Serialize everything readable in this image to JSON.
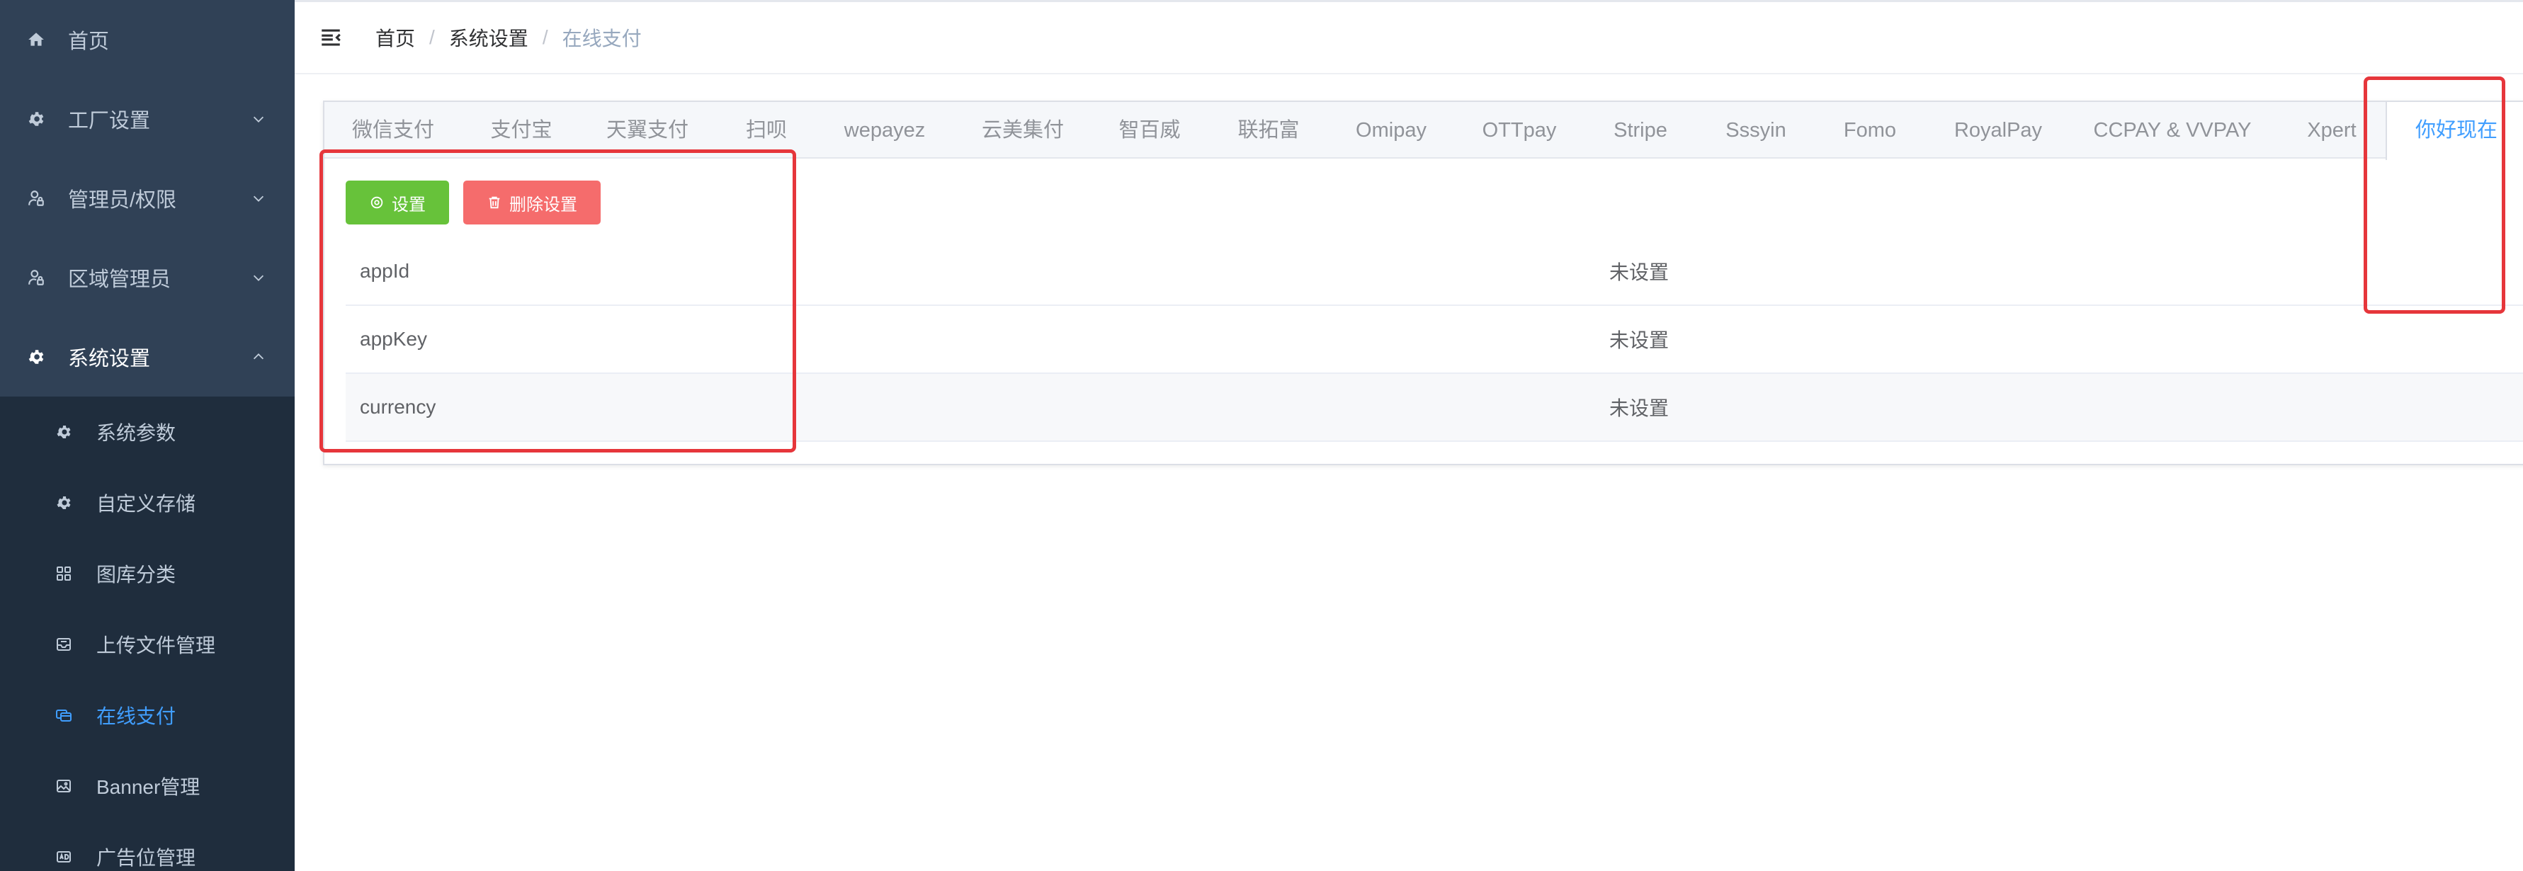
{
  "sidebar": {
    "items": [
      {
        "label": "首页",
        "icon": "home-icon",
        "has_arrow": false
      },
      {
        "label": "工厂设置",
        "icon": "gear-icon",
        "has_arrow": true,
        "arrow": "down"
      },
      {
        "label": "管理员/权限",
        "icon": "user-lock-icon",
        "has_arrow": true,
        "arrow": "down"
      },
      {
        "label": "区域管理员",
        "icon": "user-lock-icon",
        "has_arrow": true,
        "arrow": "down"
      },
      {
        "label": "系统设置",
        "icon": "gear-icon",
        "has_arrow": true,
        "arrow": "up",
        "expanded": true
      }
    ],
    "submenu": [
      {
        "label": "系统参数",
        "icon": "gear-icon"
      },
      {
        "label": "自定义存储",
        "icon": "gear-icon"
      },
      {
        "label": "图库分类",
        "icon": "grid-icon"
      },
      {
        "label": "上传文件管理",
        "icon": "inbox-icon"
      },
      {
        "label": "在线支付",
        "icon": "payment-icon",
        "active": true
      },
      {
        "label": "Banner管理",
        "icon": "image-icon"
      },
      {
        "label": "广告位管理",
        "icon": "ad-icon"
      }
    ]
  },
  "header": {
    "breadcrumb": {
      "home": "首页",
      "sep1": "/",
      "parent": "系统设置",
      "sep2": "/",
      "current": "在线支付"
    }
  },
  "tabs": [
    "微信支付",
    "支付宝",
    "天翼支付",
    "扫呗",
    "wepayez",
    "云美集付",
    "智百威",
    "联拓富",
    "Omipay",
    "OTTpay",
    "Stripe",
    "Sssyin",
    "Fomo",
    "RoyalPay",
    "CCPAY & VVPAY",
    "Xpert",
    "你好现在"
  ],
  "active_tab": "你好现在",
  "buttons": {
    "set_label": "设置",
    "delete_label": "删除设置"
  },
  "table": {
    "rows": [
      {
        "key": "appId",
        "value": "未设置"
      },
      {
        "key": "appKey",
        "value": "未设置"
      },
      {
        "key": "currency",
        "value": "未设置"
      }
    ]
  },
  "colors": {
    "sidebar_bg": "#304156",
    "submenu_bg": "#1f2d3d",
    "accent": "#409eff",
    "success": "#67c23a",
    "danger": "#f56c6c",
    "highlight": "#e6363b"
  }
}
